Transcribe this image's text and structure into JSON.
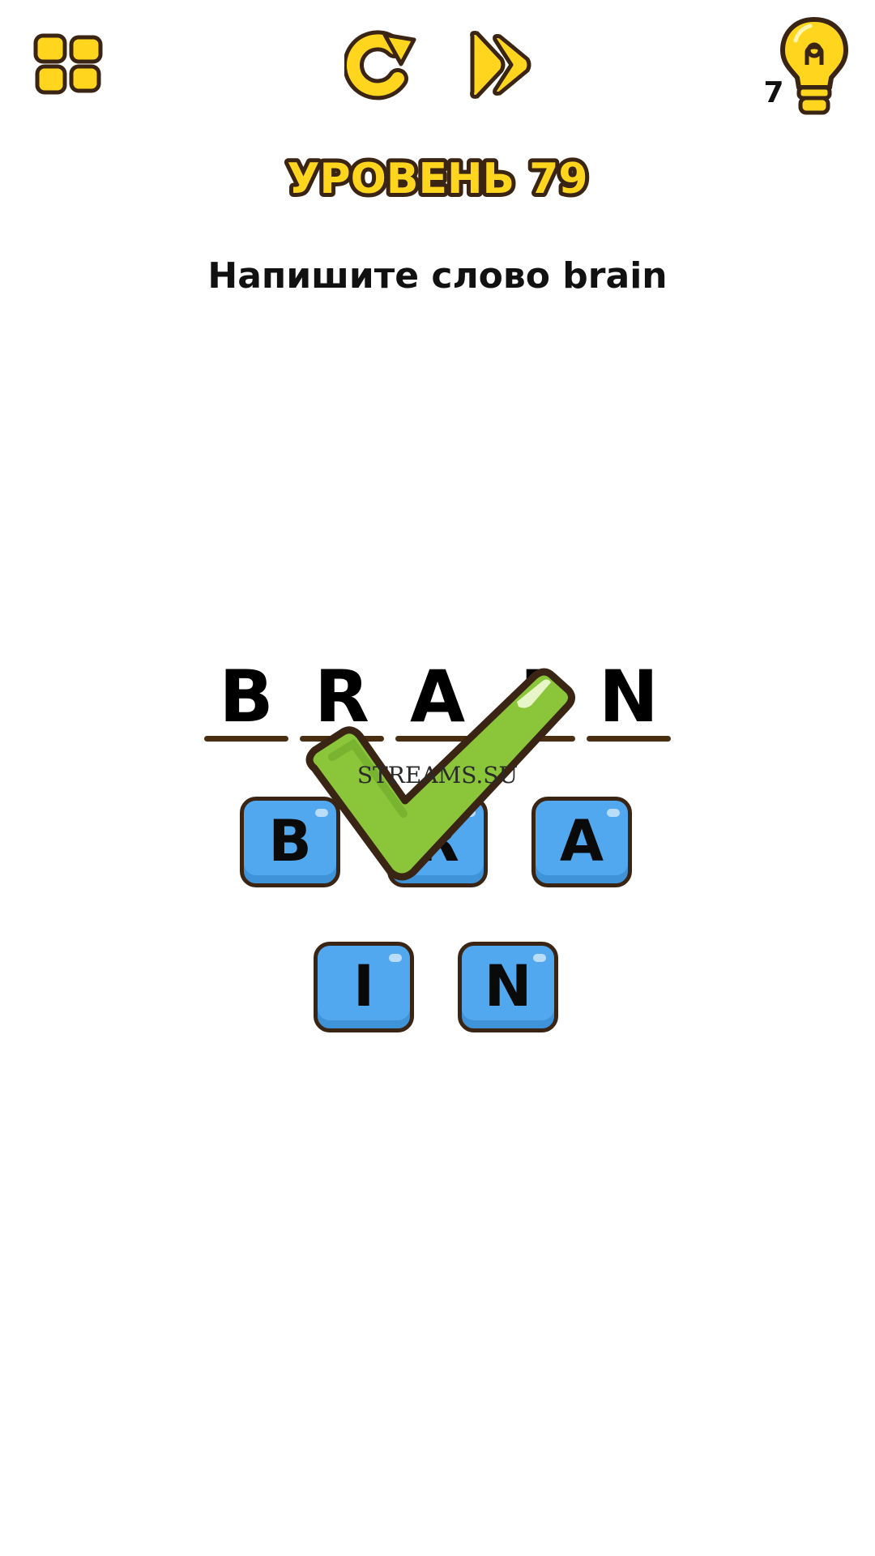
{
  "toolbar": {
    "menu_icon": "levels-grid-icon",
    "restart_icon": "restart-icon",
    "skip_icon": "skip-icon",
    "hint_icon": "lightbulb-icon",
    "hint_count": "7"
  },
  "level": {
    "title": "УРОВЕНЬ 79"
  },
  "question": "Напишите слово brain",
  "answer": {
    "letters": [
      "B",
      "R",
      "A",
      "I",
      "N"
    ]
  },
  "tiles": [
    {
      "letter": "B"
    },
    {
      "letter": "R"
    },
    {
      "letter": "A"
    },
    {
      "letter": "I"
    },
    {
      "letter": "N"
    }
  ],
  "watermark": "STREAMS.SU",
  "colors": {
    "yellow": "#ffd51e",
    "outline": "#3a2515",
    "tile_blue": "#52a8ee",
    "check_green": "#8bc53a"
  }
}
